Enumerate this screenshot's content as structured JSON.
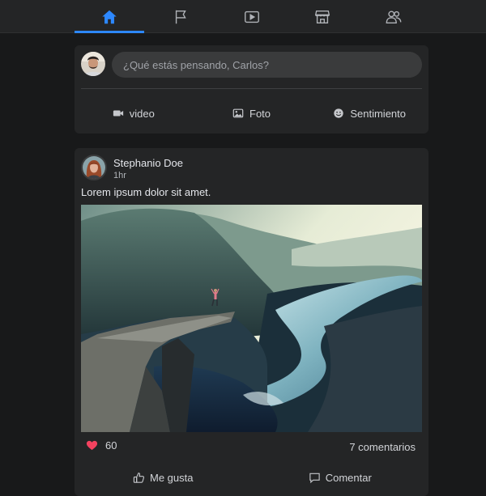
{
  "nav": {
    "tabs": [
      {
        "name": "home-icon",
        "active": true
      },
      {
        "name": "flag-icon",
        "active": false
      },
      {
        "name": "video-icon",
        "active": false
      },
      {
        "name": "marketplace-icon",
        "active": false
      },
      {
        "name": "groups-icon",
        "active": false
      }
    ],
    "accent": "#2d88ff"
  },
  "composer": {
    "placeholder": "¿Qué estás pensando, Carlos?",
    "actions": [
      {
        "label": "video",
        "icon": "video-camera-icon",
        "color": "#c5c7cb"
      },
      {
        "label": "Foto",
        "icon": "photo-icon",
        "color": "#c5c7cb"
      },
      {
        "label": "Sentimiento",
        "icon": "smile-icon",
        "color": "#c5c7cb"
      }
    ]
  },
  "post": {
    "author": "Stephanio Doe",
    "time": "1hr",
    "text": "Lorem ipsum dolor sit amet.",
    "likes": "60",
    "comments": "7 comentarios",
    "actions": [
      {
        "label": "Me gusta",
        "icon": "thumbs-up-icon"
      },
      {
        "label": "Comentar",
        "icon": "comment-icon"
      }
    ],
    "heart_color": "#f3425f"
  }
}
